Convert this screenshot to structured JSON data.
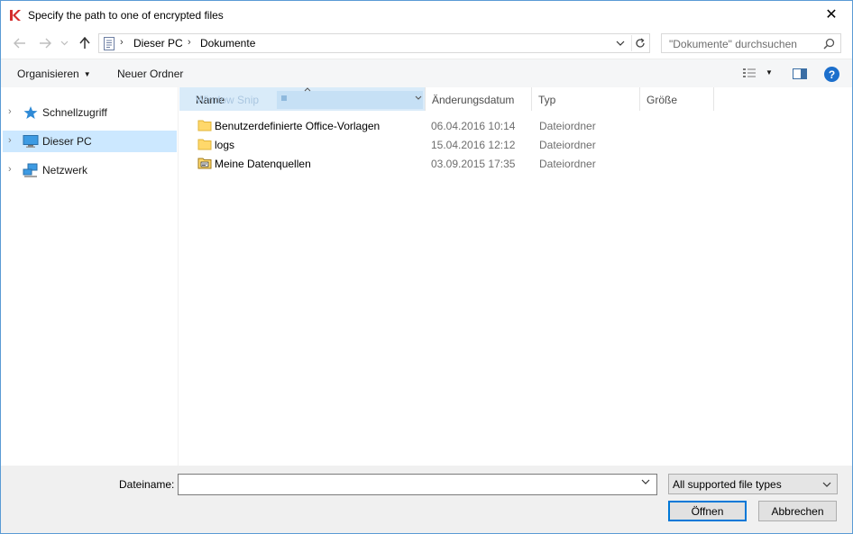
{
  "window": {
    "title": "Specify the path to one of encrypted files",
    "close_glyph": "✕"
  },
  "address": {
    "crumbs": [
      "Dieser PC",
      "Dokumente"
    ],
    "separator": "›"
  },
  "search": {
    "placeholder": "\"Dokumente\" durchsuchen"
  },
  "toolbar": {
    "organize_label": "Organisieren",
    "new_folder_label": "Neuer Ordner",
    "help_label": "?"
  },
  "sidebar": {
    "items": [
      {
        "label": "Schnellzugriff",
        "icon": "star-icon",
        "selected": false
      },
      {
        "label": "Dieser PC",
        "icon": "computer-icon",
        "selected": true
      },
      {
        "label": "Netzwerk",
        "icon": "network-icon",
        "selected": false
      }
    ]
  },
  "list": {
    "columns": {
      "name": "Name",
      "date": "Änderungsdatum",
      "type": "Typ",
      "size": "Größe"
    },
    "drag_ghost_label": "Window Snip",
    "rows": [
      {
        "name": "Benutzerdefinierte Office-Vorlagen",
        "date": "06.04.2016 10:14",
        "type": "Dateiordner",
        "icon": "folder-icon"
      },
      {
        "name": "logs",
        "date": "15.04.2016 12:12",
        "type": "Dateiordner",
        "icon": "folder-icon"
      },
      {
        "name": "Meine Datenquellen",
        "date": "03.09.2015 17:35",
        "type": "Dateiordner",
        "icon": "data-sources-folder-icon"
      }
    ]
  },
  "footer": {
    "filename_label": "Dateiname:",
    "filename_value": "",
    "filetype_selected": "All supported file types",
    "open_label": "Öffnen",
    "cancel_label": "Abbrechen"
  },
  "colors": {
    "accent": "#0078d7",
    "selection": "#cce8ff",
    "header_highlight": "#d9ebf9",
    "folder": "#ffd86b"
  }
}
